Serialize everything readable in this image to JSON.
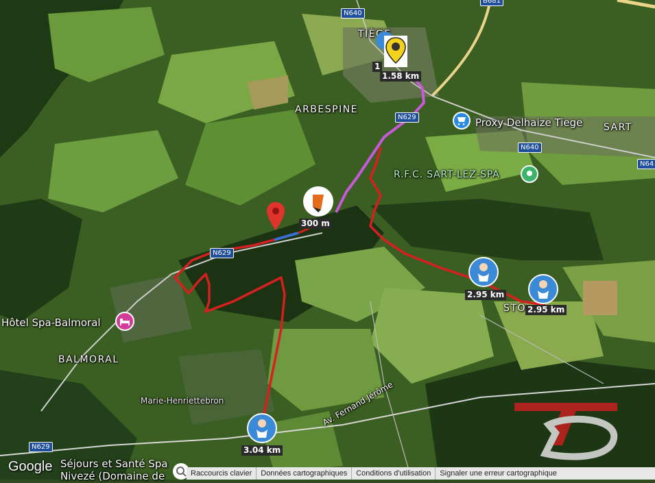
{
  "places": {
    "tiege": "TIÈGE",
    "arbespine": "ARBESPINE",
    "sart": "SART",
    "balmoral": "BALMORAL",
    "sto": "STO"
  },
  "pois": {
    "proxy_delhaize": "Proxy Delhaize Tiege",
    "rfc": "R.F.C. SART-LEZ-SPA",
    "hotel": "Hôtel Spa-Balmoral",
    "marie": "Marie-Henriettebron",
    "bottom": "Séjours et Santé Spa",
    "bottom2": "Nivezé (Domaine de",
    "street": "Av. Fernand Jérôme"
  },
  "roads": {
    "n640_top": "N640",
    "n629_top": "N629",
    "n640_right": "N640",
    "n64_edge": "N64",
    "n62_mid": "N629",
    "n629_bottom": "N629",
    "b681": "B681"
  },
  "markers": {
    "top_dist": "1.58 km",
    "top_dist_behind": "1",
    "mid_dist": "300 m",
    "baby1_dist": "2.95 km",
    "baby2_dist": "2.95 km",
    "baby3_dist": "3.04 km"
  },
  "footer": {
    "google": "Google",
    "shortcuts": "Raccourcis clavier",
    "data": "Données cartographiques",
    "terms": "Conditions d'utilisation",
    "report": "Signaler une erreur cartographique"
  },
  "colors": {
    "route_red": "#d62020",
    "route_purple": "#c65ad8",
    "route_blue": "#3a6fd8",
    "place_label": "#ffffff",
    "rfc_green": "#3cb36b",
    "poi_blue": "#2a8be0",
    "hotel_pink": "#d23c9a"
  },
  "icons": [
    "search-icon",
    "cart-icon",
    "location-pin-icon",
    "bed-icon",
    "baby-icon",
    "dog-icon",
    "tb-logo"
  ]
}
